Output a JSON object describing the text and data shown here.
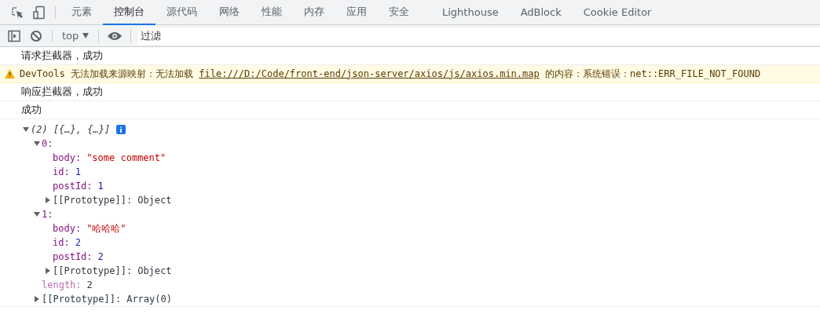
{
  "tabs": [
    {
      "label": "元素",
      "selected": false
    },
    {
      "label": "控制台",
      "selected": true
    },
    {
      "label": "源代码",
      "selected": false
    },
    {
      "label": "网络",
      "selected": false
    },
    {
      "label": "性能",
      "selected": false
    },
    {
      "label": "内存",
      "selected": false
    },
    {
      "label": "应用",
      "selected": false
    },
    {
      "label": "安全",
      "selected": false
    },
    {
      "label": "Lighthouse",
      "selected": false
    },
    {
      "label": "AdBlock",
      "selected": false
    },
    {
      "label": "Cookie Editor",
      "selected": false
    }
  ],
  "toolbar": {
    "context": "top",
    "filter": {
      "placeholder": "过滤"
    }
  },
  "messages": [
    {
      "kind": "log",
      "text": "请求拦截器，成功"
    },
    {
      "kind": "warning",
      "text": "DevTools 无法加载来源映射：无法加载",
      "link": "file:///D:/Code/front-end/json-server/axios/js/axios.min.map",
      "suffix": "的内容：系统错误：net::ERR_FILE_NOT_FOUND"
    },
    {
      "kind": "log",
      "text": "响应拦截器，成功"
    },
    {
      "kind": "log",
      "text": "成功"
    }
  ],
  "tree": {
    "summary": "(2) [{…}, {…}]",
    "expanded": true,
    "children": [
      {
        "kind": "object",
        "key": "0:",
        "expanded": true,
        "children": [
          {
            "kind": "string",
            "key": "body:",
            "value": "\"some comment\""
          },
          {
            "kind": "number",
            "key": "id:",
            "value": "1"
          },
          {
            "kind": "number",
            "key": "postId:",
            "value": "1"
          },
          {
            "kind": "proto",
            "key": "[[Prototype]]:",
            "value": "Object",
            "expanded": false
          }
        ]
      },
      {
        "kind": "object",
        "key": "1:",
        "expanded": true,
        "children": [
          {
            "kind": "string",
            "key": "body:",
            "value": "\"哈哈哈\""
          },
          {
            "kind": "number",
            "key": "id:",
            "value": "2"
          },
          {
            "kind": "number",
            "key": "postId:",
            "value": "2"
          },
          {
            "kind": "proto",
            "key": "[[Prototype]]:",
            "value": "Object",
            "expanded": false
          }
        ]
      },
      {
        "kind": "length",
        "key": "length:",
        "value": "2"
      },
      {
        "kind": "proto",
        "key": "[[Prototype]]:",
        "value": "Array(0)",
        "expanded": false
      }
    ]
  }
}
